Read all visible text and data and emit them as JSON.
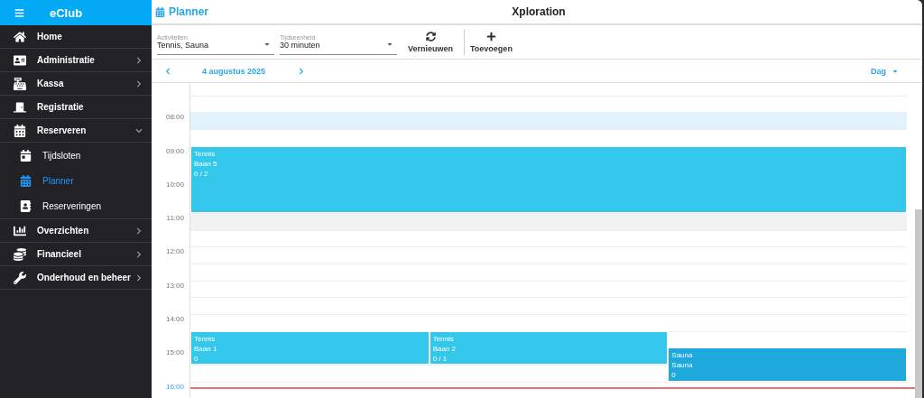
{
  "app": {
    "title": "eClub"
  },
  "sidebar": {
    "items": [
      {
        "label": "Home",
        "expandable": false,
        "selected": false
      },
      {
        "label": "Administratie",
        "expandable": true,
        "expanded": false,
        "selected": false
      },
      {
        "label": "Kassa",
        "expandable": true,
        "expanded": false,
        "selected": false
      },
      {
        "label": "Registratie",
        "expandable": false,
        "selected": false
      },
      {
        "label": "Reserveren",
        "expandable": true,
        "expanded": true,
        "selected": false,
        "children": [
          {
            "label": "Tijdsloten",
            "selected": false
          },
          {
            "label": "Planner",
            "selected": true
          },
          {
            "label": "Reserveringen",
            "selected": false
          }
        ]
      },
      {
        "label": "Overzichten",
        "expandable": true,
        "expanded": false,
        "selected": false
      },
      {
        "label": "Financieel",
        "expandable": true,
        "expanded": false,
        "selected": false
      },
      {
        "label": "Onderhoud en beheer",
        "expandable": true,
        "expanded": false,
        "selected": false
      }
    ]
  },
  "header": {
    "page": "Planner",
    "title": "Xploration"
  },
  "toolbar": {
    "fields": [
      {
        "label": "Activiteiten",
        "value": "Tennis, Sauna"
      },
      {
        "label": "Tijdseenheid",
        "value": "30 minuten"
      }
    ],
    "buttons": [
      {
        "label": "Vernieuwen"
      },
      {
        "label": "Toevoegen"
      }
    ]
  },
  "datebar": {
    "date": "4 augustus 2025",
    "view": "Dag"
  },
  "calendar": {
    "hours": [
      {
        "label": "08:00",
        "current": false
      },
      {
        "label": "09:00",
        "current": false
      },
      {
        "label": "10:00",
        "current": false
      },
      {
        "label": "11:00",
        "current": false
      },
      {
        "label": "12:00",
        "current": false
      },
      {
        "label": "13:00",
        "current": false
      },
      {
        "label": "14:00",
        "current": false
      },
      {
        "label": "15:00",
        "current": false
      },
      {
        "label": "16:00",
        "current": true
      }
    ],
    "events": [
      {
        "activity": "Tennis",
        "resource": "Baan 5",
        "count": "0 / 2",
        "color": "#33c8eb"
      },
      {
        "activity": "Tennis",
        "resource": "Baan 1",
        "count": "0",
        "color": "#33c8eb"
      },
      {
        "activity": "Tennis",
        "resource": "Baan 2",
        "count": "0 / 1",
        "color": "#33c8eb"
      },
      {
        "activity": "Sauna",
        "resource": "Sauna",
        "count": "0",
        "color": "#1ea8dc"
      }
    ]
  }
}
